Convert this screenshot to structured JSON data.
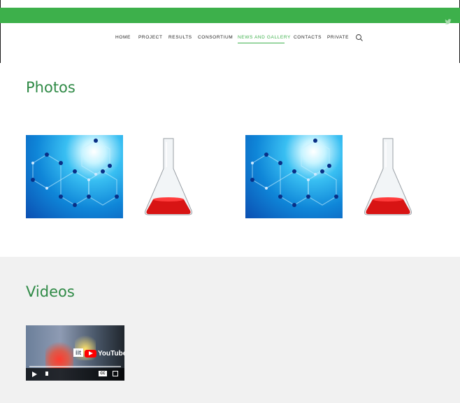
{
  "colors": {
    "brand_green": "#3db04b",
    "title_green": "#2f8a46",
    "nav_text": "#222222",
    "video_bg": "#f1f1f1"
  },
  "topbar": {
    "social_icon": "twitter-icon"
  },
  "nav": {
    "items": [
      "HOME",
      "PROJECT",
      "RESULTS",
      "CONSORTIUM",
      "NEWS AND GALLERY",
      "CONTACTS",
      "PRIVATE"
    ],
    "active": "NEWS AND GALLERY",
    "search_icon": "search-icon"
  },
  "photos": {
    "title": "Photos",
    "images": [
      "molecule-image",
      "flask-image",
      "molecule-image",
      "flask-image"
    ]
  },
  "videos": {
    "title": "Videos",
    "player": {
      "logo_text": "iit",
      "brand": "YouTube",
      "cc": "CC"
    }
  }
}
